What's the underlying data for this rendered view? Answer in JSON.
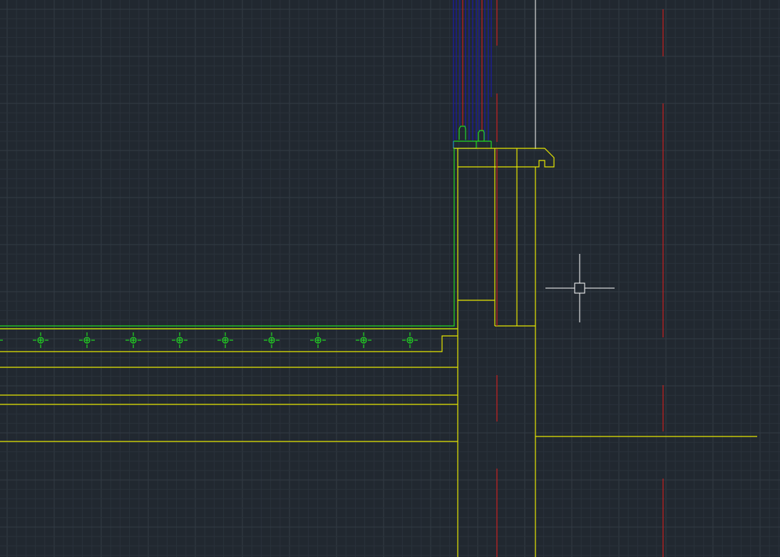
{
  "app": {
    "type": "cad-drawing-canvas"
  },
  "colors": {
    "background": "#212830",
    "grid_minor": "#2a323b",
    "grid_major": "#323b45",
    "yellow": "#e6e600",
    "green": "#22d822",
    "red": "#c81e1e",
    "blue": "#1a1aa8",
    "cyan": "#1e8fbf",
    "white": "#d8d8d8",
    "crosshair": "#ffffff"
  },
  "canvas": {
    "grid_visible": true
  },
  "cursor": {
    "icon": "crosshair-pickbox-icon"
  }
}
